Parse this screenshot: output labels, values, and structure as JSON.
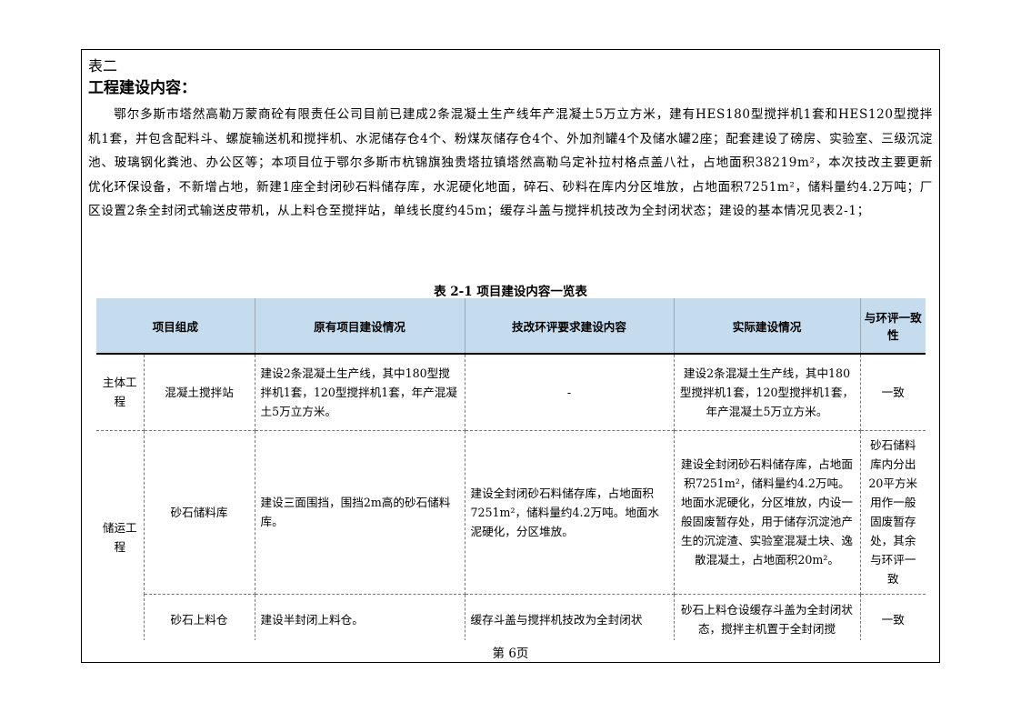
{
  "page": {
    "table_label": "表二",
    "heading": "工程建设内容：",
    "paragraph": "鄂尔多斯市塔然高勒万蒙商砼有限责任公司目前已建成2条混凝土生产线年产混凝土5万立方米，建有HES180型搅拌机1套和HES120型搅拌机1套，并包含配料斗、螺旋输送机和搅拌机、水泥储存仓4个、粉煤灰储存仓4个、外加剂罐4个及储水罐2座；配套建设了磅房、实验室、三级沉淀池、玻璃钢化粪池、办公区等；本项目位于鄂尔多斯市杭锦旗独贵塔拉镇塔然高勒乌定补拉村格点盖八社，占地面积38219m²，本次技改主要更新优化环保设备，不新增占地，新建1座全封闭砂石料储存库，水泥硬化地面，碎石、砂料在库内分区堆放，占地面积7251m²，储料量约4.2万吨；厂区设置2条全封闭式输送皮带机，从上料仓至搅拌站，单线长度约45m；缓存斗盖与搅拌机技改为全封闭状态；建设的基本情况见表2-1；",
    "caption": "表 2-1  项目建设内容一览表",
    "footer": "第 6页"
  },
  "table": {
    "headers": [
      "项目组成",
      "原有项目建设情况",
      "技改环评要求建设内容",
      "实际建设情况",
      "与环评一致性"
    ],
    "rows": [
      {
        "category": "主体工程",
        "item": "混凝土搅拌站",
        "original": "建设2条混凝土生产线，其中180型搅拌机1套，120型搅拌机1套，年产混凝土5万立方米。",
        "required": "-",
        "actual": "建设2条混凝土生产线，其中180型搅拌机1套，120型搅拌机1套，年产混凝土5万立方米。",
        "consistency": "一致"
      },
      {
        "category": "储运工程",
        "item": "砂石储料库",
        "original": "建设三面围挡，围挡2m高的砂石储料库。",
        "required": "建设全封闭砂石料储存库，占地面积7251m²，储料量约4.2万吨。地面水泥硬化，分区堆放。",
        "actual": "建设全封闭砂石料储存库，占地面积7251m²，储料量约4.2万吨。地面水泥硬化，分区堆放，内设一般固废暂存处，用于储存沉淀池产生的沉淀渣、实验室混凝土块、逸散混凝土，占地面积20m²。",
        "consistency": "砂石储料库内分出20平方米用作一般固废暂存处，其余与环评一致"
      },
      {
        "category": "",
        "item": "砂石上料仓",
        "original": "建设半封闭上料仓。",
        "required": "缓存斗盖与搅拌机技改为全封闭状",
        "actual": "砂石上料仓设缓存斗盖为全封闭状态，搅拌主机置于全封闭搅",
        "consistency": "一致"
      }
    ]
  }
}
